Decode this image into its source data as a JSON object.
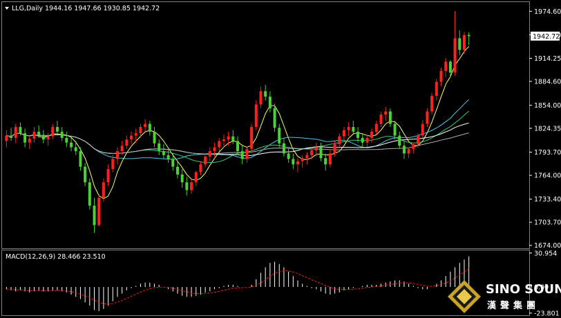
{
  "header": {
    "symbol_label": "LLG,Daily",
    "ohlc_label": "1944.16 1947.66 1930.85 1942.72",
    "macd_label": "MACD(12,26,9) 28.466 23.510"
  },
  "brand": {
    "name_en": "SINO SOUND",
    "name_zh": "漢聲集團"
  },
  "colors": {
    "background": "#000000",
    "up": "#ff2020",
    "down": "#4cd137",
    "axis": "#ffffff",
    "ma_fast": "#ffff66",
    "ma_mid": "#4cc9f0",
    "ma_green": "#2ecc71",
    "ma_white": "#ffffff",
    "ma_gray": "#b0b0b0",
    "signal": "#ff2020",
    "price_box": "#ffffff"
  },
  "chart_data": {
    "type": "candlestick",
    "price_ticks": [
      "1974.60",
      "1944.30",
      "1914.25",
      "1884.60",
      "1854.00",
      "1824.35",
      "1793.70",
      "1764.00",
      "1733.40",
      "1703.70",
      "1674.00"
    ],
    "price_tick_values": [
      1974.6,
      1944.3,
      1914.25,
      1884.6,
      1854.0,
      1824.35,
      1793.7,
      1764.0,
      1733.4,
      1703.7,
      1674.0
    ],
    "price_range": [
      1672,
      1982
    ],
    "last_price_label": "1942.72",
    "last_price": 1942.72,
    "macd_ticks": [
      "30.954",
      "0.00",
      "-23.801"
    ],
    "macd_tick_values": [
      30.954,
      0.0,
      -23.801
    ],
    "macd_range": [
      -24.5,
      31.5
    ],
    "candles": [
      [
        1808,
        1822,
        1800,
        1815
      ],
      [
        1815,
        1825,
        1808,
        1812
      ],
      [
        1812,
        1830,
        1805,
        1826
      ],
      [
        1826,
        1832,
        1815,
        1818
      ],
      [
        1818,
        1824,
        1800,
        1806
      ],
      [
        1806,
        1815,
        1798,
        1811
      ],
      [
        1811,
        1826,
        1806,
        1820
      ],
      [
        1820,
        1828,
        1812,
        1816
      ],
      [
        1816,
        1822,
        1805,
        1810
      ],
      [
        1810,
        1818,
        1802,
        1814
      ],
      [
        1814,
        1830,
        1810,
        1826
      ],
      [
        1826,
        1834,
        1815,
        1820
      ],
      [
        1820,
        1826,
        1808,
        1812
      ],
      [
        1812,
        1820,
        1800,
        1806
      ],
      [
        1806,
        1812,
        1795,
        1800
      ],
      [
        1800,
        1808,
        1790,
        1795
      ],
      [
        1795,
        1800,
        1770,
        1775
      ],
      [
        1775,
        1780,
        1750,
        1755
      ],
      [
        1755,
        1760,
        1720,
        1725
      ],
      [
        1725,
        1735,
        1690,
        1700
      ],
      [
        1700,
        1740,
        1698,
        1735
      ],
      [
        1735,
        1760,
        1730,
        1755
      ],
      [
        1755,
        1778,
        1750,
        1772
      ],
      [
        1772,
        1790,
        1768,
        1785
      ],
      [
        1785,
        1800,
        1778,
        1795
      ],
      [
        1795,
        1808,
        1790,
        1802
      ],
      [
        1802,
        1815,
        1798,
        1810
      ],
      [
        1810,
        1820,
        1804,
        1815
      ],
      [
        1815,
        1824,
        1806,
        1818
      ],
      [
        1818,
        1830,
        1812,
        1826
      ],
      [
        1826,
        1836,
        1820,
        1830
      ],
      [
        1830,
        1834,
        1815,
        1820
      ],
      [
        1820,
        1826,
        1800,
        1805
      ],
      [
        1805,
        1810,
        1790,
        1795
      ],
      [
        1795,
        1804,
        1785,
        1790
      ],
      [
        1790,
        1798,
        1780,
        1785
      ],
      [
        1785,
        1792,
        1770,
        1775
      ],
      [
        1775,
        1782,
        1760,
        1765
      ],
      [
        1765,
        1772,
        1748,
        1755
      ],
      [
        1755,
        1762,
        1738,
        1745
      ],
      [
        1745,
        1758,
        1740,
        1755
      ],
      [
        1755,
        1770,
        1750,
        1768
      ],
      [
        1768,
        1782,
        1764,
        1778
      ],
      [
        1778,
        1792,
        1774,
        1788
      ],
      [
        1788,
        1800,
        1782,
        1795
      ],
      [
        1795,
        1806,
        1788,
        1800
      ],
      [
        1800,
        1812,
        1794,
        1808
      ],
      [
        1808,
        1816,
        1800,
        1810
      ],
      [
        1810,
        1820,
        1802,
        1814
      ],
      [
        1814,
        1822,
        1804,
        1808
      ],
      [
        1808,
        1814,
        1790,
        1795
      ],
      [
        1795,
        1802,
        1778,
        1785
      ],
      [
        1785,
        1800,
        1780,
        1798
      ],
      [
        1798,
        1830,
        1795,
        1826
      ],
      [
        1826,
        1860,
        1822,
        1855
      ],
      [
        1855,
        1878,
        1850,
        1872
      ],
      [
        1872,
        1880,
        1860,
        1865
      ],
      [
        1865,
        1872,
        1845,
        1850
      ],
      [
        1850,
        1856,
        1820,
        1825
      ],
      [
        1825,
        1830,
        1800,
        1805
      ],
      [
        1805,
        1812,
        1788,
        1792
      ],
      [
        1792,
        1798,
        1780,
        1785
      ],
      [
        1785,
        1792,
        1772,
        1778
      ],
      [
        1778,
        1786,
        1768,
        1782
      ],
      [
        1782,
        1790,
        1774,
        1786
      ],
      [
        1786,
        1794,
        1778,
        1790
      ],
      [
        1790,
        1800,
        1784,
        1796
      ],
      [
        1796,
        1806,
        1788,
        1800
      ],
      [
        1800,
        1806,
        1782,
        1786
      ],
      [
        1786,
        1792,
        1770,
        1778
      ],
      [
        1778,
        1796,
        1774,
        1792
      ],
      [
        1792,
        1808,
        1788,
        1804
      ],
      [
        1804,
        1818,
        1800,
        1814
      ],
      [
        1814,
        1826,
        1808,
        1822
      ],
      [
        1822,
        1832,
        1814,
        1826
      ],
      [
        1826,
        1834,
        1816,
        1820
      ],
      [
        1820,
        1826,
        1806,
        1812
      ],
      [
        1812,
        1818,
        1800,
        1806
      ],
      [
        1806,
        1816,
        1800,
        1812
      ],
      [
        1812,
        1824,
        1806,
        1820
      ],
      [
        1820,
        1834,
        1816,
        1830
      ],
      [
        1830,
        1846,
        1826,
        1842
      ],
      [
        1842,
        1852,
        1834,
        1846
      ],
      [
        1846,
        1850,
        1826,
        1830
      ],
      [
        1830,
        1834,
        1810,
        1815
      ],
      [
        1815,
        1820,
        1798,
        1802
      ],
      [
        1802,
        1808,
        1785,
        1792
      ],
      [
        1792,
        1800,
        1786,
        1798
      ],
      [
        1798,
        1806,
        1792,
        1804
      ],
      [
        1804,
        1818,
        1800,
        1815
      ],
      [
        1815,
        1835,
        1812,
        1830
      ],
      [
        1830,
        1850,
        1826,
        1846
      ],
      [
        1846,
        1870,
        1842,
        1866
      ],
      [
        1866,
        1888,
        1860,
        1884
      ],
      [
        1884,
        1902,
        1878,
        1898
      ],
      [
        1898,
        1915,
        1890,
        1910
      ],
      [
        1910,
        1912,
        1890,
        1896
      ],
      [
        1896,
        1975,
        1892,
        1940
      ],
      [
        1940,
        1950,
        1918,
        1925
      ],
      [
        1925,
        1948,
        1920,
        1944
      ],
      [
        1944.16,
        1947.66,
        1930.85,
        1942.72
      ]
    ],
    "macd_hist": [
      -2,
      -3,
      -4,
      -3,
      -4,
      -5,
      -4,
      -3,
      -4,
      -4,
      -3,
      -3,
      -4,
      -5,
      -7,
      -9,
      -11,
      -14,
      -17,
      -21,
      -22,
      -20,
      -17,
      -13,
      -9,
      -6,
      -3,
      -1,
      1,
      3,
      4,
      4,
      3,
      2,
      0,
      -2,
      -4,
      -6,
      -8,
      -9,
      -9,
      -8,
      -7,
      -5,
      -4,
      -2,
      -1,
      1,
      2,
      2,
      1,
      0,
      0,
      2,
      7,
      13,
      18,
      22,
      23,
      21,
      18,
      14,
      10,
      6,
      3,
      1,
      -1,
      -2,
      -4,
      -6,
      -7,
      -6,
      -5,
      -3,
      -2,
      -1,
      0,
      1,
      2,
      2,
      2,
      3,
      4,
      5,
      6,
      6,
      5,
      3,
      1,
      -1,
      -2,
      -2,
      0,
      3,
      6,
      10,
      14,
      18,
      22,
      25,
      28
    ],
    "ma_period_note": ""
  }
}
